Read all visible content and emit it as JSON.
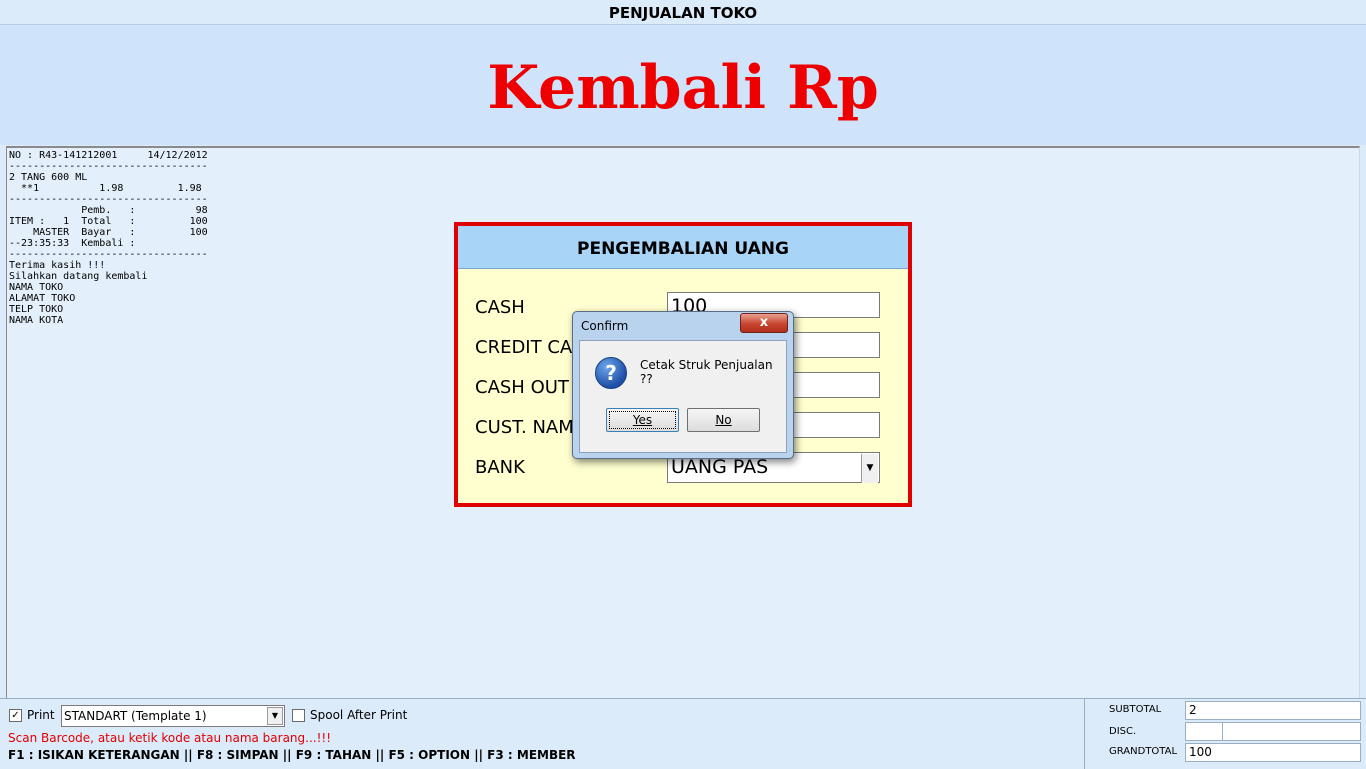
{
  "window": {
    "title": "PENJUALAN TOKO"
  },
  "header": {
    "display": "Kembali Rp"
  },
  "receipt": {
    "text": "NO : R43-141212001     14/12/2012\n---------------------------------\n2 TANG 600 ML\n  **1          1.98         1.98\n---------------------------------\n            Pemb.   :          98\nITEM :   1  Total   :         100\n    MASTER  Bayar   :         100\n--23:35:33  Kembali :\n---------------------------------\nTerima kasih !!!\nSilahkan datang kembali\nNAMA TOKO\nALAMAT TOKO\nTELP TOKO\nNAMA KOTA"
  },
  "refund_panel": {
    "title": "PENGEMBALIAN UANG",
    "fields": [
      {
        "label": "CASH",
        "value": "100"
      },
      {
        "label": "CREDIT CARD",
        "value": ""
      },
      {
        "label": "CASH OUT",
        "value": ""
      },
      {
        "label": "CUST. NAME",
        "value": ""
      }
    ],
    "bank": {
      "label": "BANK",
      "value": "UANG PAS"
    }
  },
  "dialog": {
    "title": "Confirm",
    "close": "x",
    "message": "Cetak Struk Penjualan ??",
    "icon": "question-icon",
    "yes": "Yes",
    "no": "No"
  },
  "bottom": {
    "print_label": "Print",
    "print_checked": true,
    "template": "STANDART (Template 1)",
    "spool_label": "Spool After Print",
    "spool_checked": false,
    "scan_hint": "Scan Barcode, atau ketik kode atau nama barang...!!!",
    "shortcuts": "F1 : ISIKAN KETERANGAN || F8 : SIMPAN || F9 : TAHAN || F5 : OPTION || F3 : MEMBER"
  },
  "totals": {
    "subtotal_label": "SUBTOTAL",
    "subtotal": "2",
    "disc_label": "DISC.",
    "disc": "",
    "grandtotal_label": "GRANDTOTAL",
    "grandtotal": "100"
  },
  "colors": {
    "accent_red": "#ee0000",
    "panel_bg": "#ffffd0",
    "panel_head": "#a8d4f8"
  }
}
